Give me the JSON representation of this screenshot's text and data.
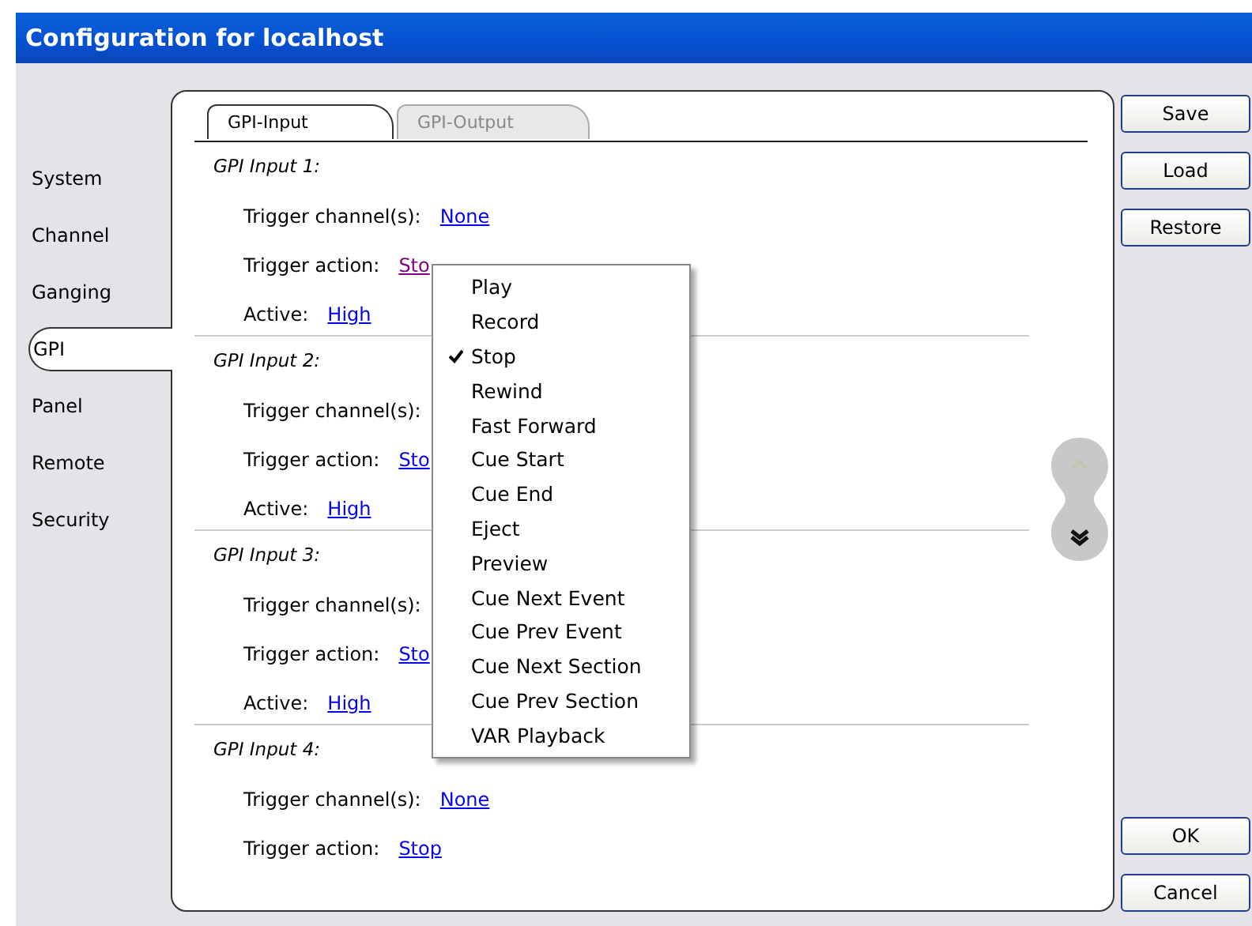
{
  "window": {
    "title": "Configuration for localhost"
  },
  "sidebar": {
    "items": [
      {
        "label": "System",
        "selected": false
      },
      {
        "label": "Channel",
        "selected": false
      },
      {
        "label": "Ganging",
        "selected": false
      },
      {
        "label": "GPI",
        "selected": true
      },
      {
        "label": "Panel",
        "selected": false
      },
      {
        "label": "Remote",
        "selected": false
      },
      {
        "label": "Security",
        "selected": false
      }
    ]
  },
  "tabs": [
    {
      "label": "GPI-Input",
      "selected": true
    },
    {
      "label": "GPI-Output",
      "selected": false
    }
  ],
  "inputs": [
    {
      "title": "GPI Input 1:",
      "fields": [
        {
          "label": "Trigger channel(s):",
          "value": "None",
          "visited": false
        },
        {
          "label": "Trigger action:",
          "value": "Sto",
          "visited": true
        },
        {
          "label": "Active:",
          "value": "High",
          "visited": false
        }
      ]
    },
    {
      "title": "GPI Input 2:",
      "fields": [
        {
          "label": "Trigger channel(s):"
        },
        {
          "label": "Trigger action:",
          "value": "Sto",
          "visited": false
        },
        {
          "label": "Active:",
          "value": "High",
          "visited": false
        }
      ]
    },
    {
      "title": "GPI Input 3:",
      "fields": [
        {
          "label": "Trigger channel(s):"
        },
        {
          "label": "Trigger action:",
          "value": "Sto",
          "visited": false
        },
        {
          "label": "Active:",
          "value": "High",
          "visited": false
        }
      ]
    },
    {
      "title": "GPI Input 4:",
      "fields": [
        {
          "label": "Trigger channel(s):",
          "value": "None",
          "visited": false
        },
        {
          "label": "Trigger action:",
          "value": "Stop",
          "visited": false
        }
      ]
    }
  ],
  "menu": {
    "items": [
      {
        "label": "Play",
        "checked": false
      },
      {
        "label": "Record",
        "checked": false
      },
      {
        "label": "Stop",
        "checked": true
      },
      {
        "label": "Rewind",
        "checked": false
      },
      {
        "label": "Fast Forward",
        "checked": false
      },
      {
        "label": "Cue Start",
        "checked": false
      },
      {
        "label": "Cue End",
        "checked": false
      },
      {
        "label": "Eject",
        "checked": false
      },
      {
        "label": "Preview",
        "checked": false
      },
      {
        "label": "Cue Next Event",
        "checked": false
      },
      {
        "label": "Cue Prev Event",
        "checked": false
      },
      {
        "label": "Cue Next Section",
        "checked": false
      },
      {
        "label": "Cue Prev Section",
        "checked": false
      },
      {
        "label": "VAR Playback",
        "checked": false
      }
    ]
  },
  "buttons_top": [
    "Save",
    "Load",
    "Restore"
  ],
  "buttons_bottom": [
    "OK",
    "Cancel"
  ]
}
